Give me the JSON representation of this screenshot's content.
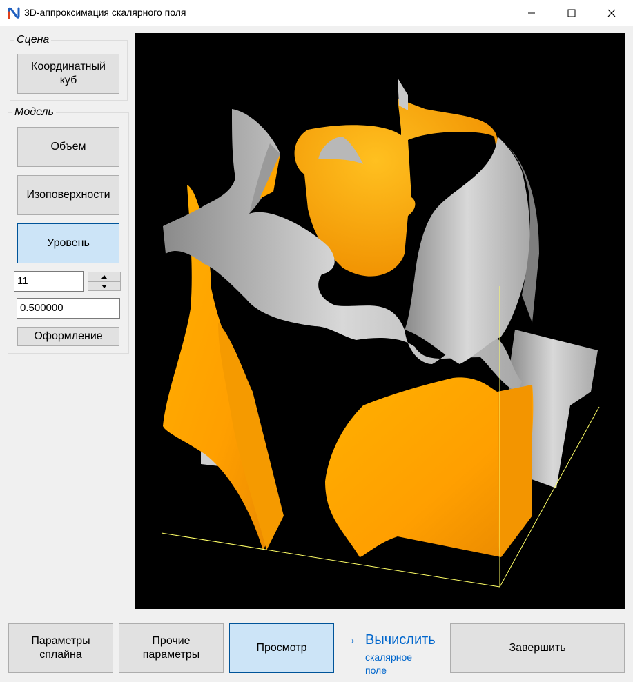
{
  "window": {
    "title": "3D-аппроксимация скалярного поля",
    "icons": {
      "app": "app-logo-icon",
      "minimize": "minimize-icon",
      "maximize": "maximize-icon",
      "close": "close-icon"
    }
  },
  "scene_group": {
    "legend": "Сцена",
    "coord_cube_button": "Координатный\nкуб"
  },
  "model_group": {
    "legend": "Модель",
    "volume_button": "Объем",
    "isosurfaces_button": "Изоповерхности",
    "level_button": "Уровень",
    "level_count_value": "11",
    "level_value": "0.500000",
    "design_button": "Оформление"
  },
  "bottom_bar": {
    "spline_params_button": "Параметры\nсплайна",
    "other_params_button": "Прочие\nпараметры",
    "preview_button": "Просмотр",
    "compute_link_arrow": "→",
    "compute_link_main": "Вычислить",
    "compute_link_sub": "скалярное\nполе",
    "finish_button": "Завершить"
  },
  "colors": {
    "accent_blue": "#0066cc",
    "active_button_bg": "#cce4f7",
    "surface_orange": "#ffa500",
    "surface_gray": "#c8c8c8",
    "axes_yellow": "#ffff66",
    "viewport_bg": "#000000"
  }
}
